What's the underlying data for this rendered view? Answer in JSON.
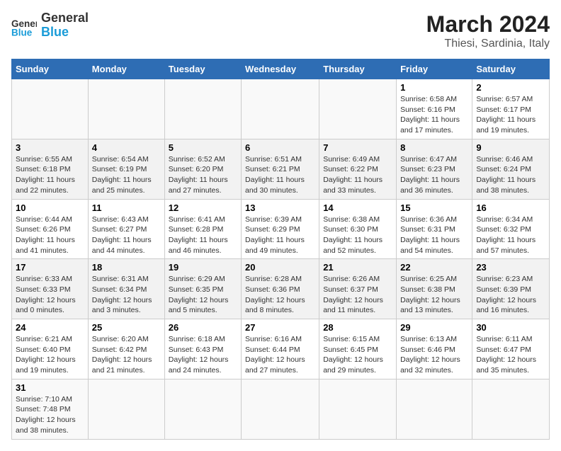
{
  "header": {
    "logo_general": "General",
    "logo_blue": "Blue",
    "title": "March 2024",
    "subtitle": "Thiesi, Sardinia, Italy"
  },
  "weekdays": [
    "Sunday",
    "Monday",
    "Tuesday",
    "Wednesday",
    "Thursday",
    "Friday",
    "Saturday"
  ],
  "weeks": [
    [
      {
        "day": "",
        "info": ""
      },
      {
        "day": "",
        "info": ""
      },
      {
        "day": "",
        "info": ""
      },
      {
        "day": "",
        "info": ""
      },
      {
        "day": "",
        "info": ""
      },
      {
        "day": "1",
        "info": "Sunrise: 6:58 AM\nSunset: 6:16 PM\nDaylight: 11 hours and 17 minutes."
      },
      {
        "day": "2",
        "info": "Sunrise: 6:57 AM\nSunset: 6:17 PM\nDaylight: 11 hours and 19 minutes."
      }
    ],
    [
      {
        "day": "3",
        "info": "Sunrise: 6:55 AM\nSunset: 6:18 PM\nDaylight: 11 hours and 22 minutes."
      },
      {
        "day": "4",
        "info": "Sunrise: 6:54 AM\nSunset: 6:19 PM\nDaylight: 11 hours and 25 minutes."
      },
      {
        "day": "5",
        "info": "Sunrise: 6:52 AM\nSunset: 6:20 PM\nDaylight: 11 hours and 27 minutes."
      },
      {
        "day": "6",
        "info": "Sunrise: 6:51 AM\nSunset: 6:21 PM\nDaylight: 11 hours and 30 minutes."
      },
      {
        "day": "7",
        "info": "Sunrise: 6:49 AM\nSunset: 6:22 PM\nDaylight: 11 hours and 33 minutes."
      },
      {
        "day": "8",
        "info": "Sunrise: 6:47 AM\nSunset: 6:23 PM\nDaylight: 11 hours and 36 minutes."
      },
      {
        "day": "9",
        "info": "Sunrise: 6:46 AM\nSunset: 6:24 PM\nDaylight: 11 hours and 38 minutes."
      }
    ],
    [
      {
        "day": "10",
        "info": "Sunrise: 6:44 AM\nSunset: 6:26 PM\nDaylight: 11 hours and 41 minutes."
      },
      {
        "day": "11",
        "info": "Sunrise: 6:43 AM\nSunset: 6:27 PM\nDaylight: 11 hours and 44 minutes."
      },
      {
        "day": "12",
        "info": "Sunrise: 6:41 AM\nSunset: 6:28 PM\nDaylight: 11 hours and 46 minutes."
      },
      {
        "day": "13",
        "info": "Sunrise: 6:39 AM\nSunset: 6:29 PM\nDaylight: 11 hours and 49 minutes."
      },
      {
        "day": "14",
        "info": "Sunrise: 6:38 AM\nSunset: 6:30 PM\nDaylight: 11 hours and 52 minutes."
      },
      {
        "day": "15",
        "info": "Sunrise: 6:36 AM\nSunset: 6:31 PM\nDaylight: 11 hours and 54 minutes."
      },
      {
        "day": "16",
        "info": "Sunrise: 6:34 AM\nSunset: 6:32 PM\nDaylight: 11 hours and 57 minutes."
      }
    ],
    [
      {
        "day": "17",
        "info": "Sunrise: 6:33 AM\nSunset: 6:33 PM\nDaylight: 12 hours and 0 minutes."
      },
      {
        "day": "18",
        "info": "Sunrise: 6:31 AM\nSunset: 6:34 PM\nDaylight: 12 hours and 3 minutes."
      },
      {
        "day": "19",
        "info": "Sunrise: 6:29 AM\nSunset: 6:35 PM\nDaylight: 12 hours and 5 minutes."
      },
      {
        "day": "20",
        "info": "Sunrise: 6:28 AM\nSunset: 6:36 PM\nDaylight: 12 hours and 8 minutes."
      },
      {
        "day": "21",
        "info": "Sunrise: 6:26 AM\nSunset: 6:37 PM\nDaylight: 12 hours and 11 minutes."
      },
      {
        "day": "22",
        "info": "Sunrise: 6:25 AM\nSunset: 6:38 PM\nDaylight: 12 hours and 13 minutes."
      },
      {
        "day": "23",
        "info": "Sunrise: 6:23 AM\nSunset: 6:39 PM\nDaylight: 12 hours and 16 minutes."
      }
    ],
    [
      {
        "day": "24",
        "info": "Sunrise: 6:21 AM\nSunset: 6:40 PM\nDaylight: 12 hours and 19 minutes."
      },
      {
        "day": "25",
        "info": "Sunrise: 6:20 AM\nSunset: 6:42 PM\nDaylight: 12 hours and 21 minutes."
      },
      {
        "day": "26",
        "info": "Sunrise: 6:18 AM\nSunset: 6:43 PM\nDaylight: 12 hours and 24 minutes."
      },
      {
        "day": "27",
        "info": "Sunrise: 6:16 AM\nSunset: 6:44 PM\nDaylight: 12 hours and 27 minutes."
      },
      {
        "day": "28",
        "info": "Sunrise: 6:15 AM\nSunset: 6:45 PM\nDaylight: 12 hours and 29 minutes."
      },
      {
        "day": "29",
        "info": "Sunrise: 6:13 AM\nSunset: 6:46 PM\nDaylight: 12 hours and 32 minutes."
      },
      {
        "day": "30",
        "info": "Sunrise: 6:11 AM\nSunset: 6:47 PM\nDaylight: 12 hours and 35 minutes."
      }
    ],
    [
      {
        "day": "31",
        "info": "Sunrise: 7:10 AM\nSunset: 7:48 PM\nDaylight: 12 hours and 38 minutes."
      },
      {
        "day": "",
        "info": ""
      },
      {
        "day": "",
        "info": ""
      },
      {
        "day": "",
        "info": ""
      },
      {
        "day": "",
        "info": ""
      },
      {
        "day": "",
        "info": ""
      },
      {
        "day": "",
        "info": ""
      }
    ]
  ]
}
